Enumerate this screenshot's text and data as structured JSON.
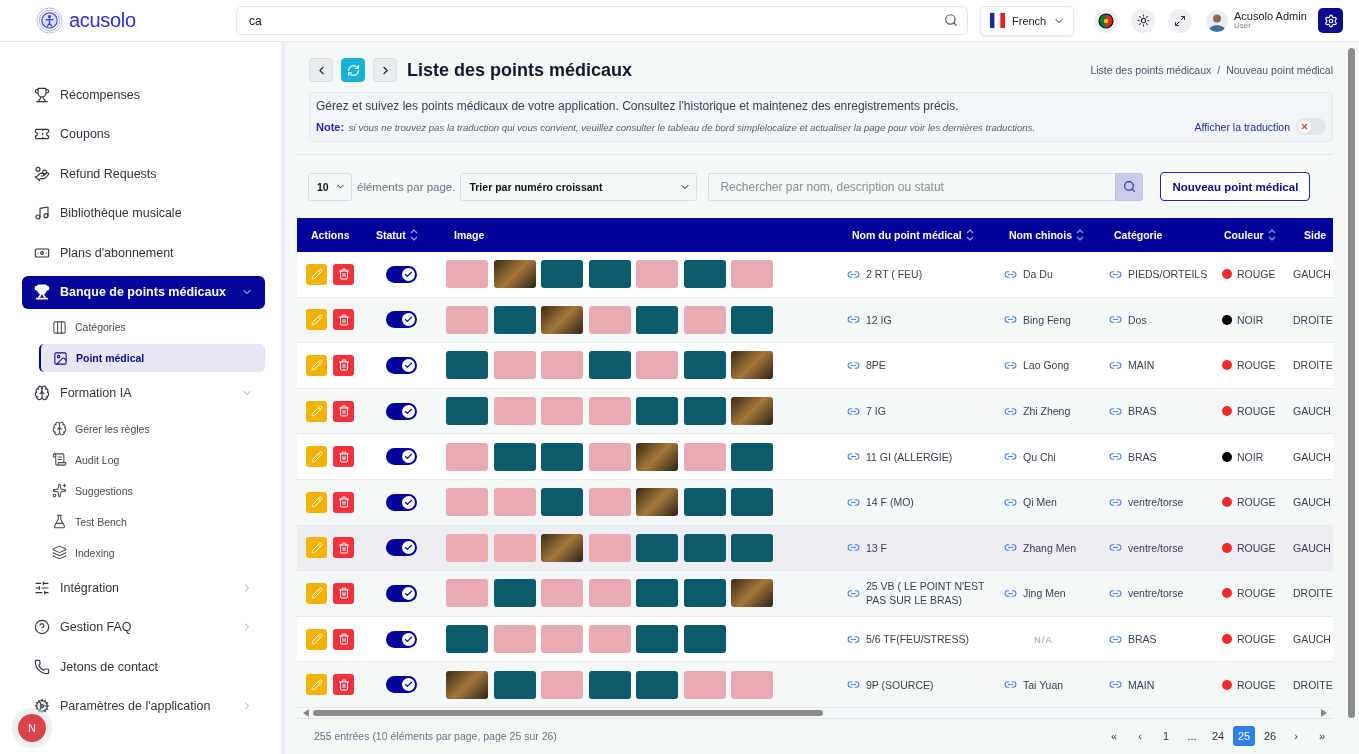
{
  "header": {
    "logo": "acusolo",
    "search": {
      "value": "ca"
    },
    "language": "French",
    "user": {
      "name": "Acusolo Admin",
      "role": "User"
    }
  },
  "sidebar": {
    "items": [
      {
        "label": "Récompenses"
      },
      {
        "label": "Coupons"
      },
      {
        "label": "Refund Requests"
      },
      {
        "label": "Bibliothèque musicale"
      },
      {
        "label": "Plans d'abonnement"
      },
      {
        "label": "Banque de points médicaux",
        "selected": true,
        "expanded": true,
        "children": [
          {
            "label": "Catégories",
            "selected": false
          },
          {
            "label": "Point médical",
            "selected": true
          }
        ]
      },
      {
        "label": "Formation IA",
        "selected": false,
        "expanded": true,
        "children": [
          {
            "label": "Gérer les règles",
            "selected": false
          },
          {
            "label": "Audit Log",
            "selected": false
          },
          {
            "label": "Suggestions",
            "selected": false
          },
          {
            "label": "Test Bench",
            "selected": false
          },
          {
            "label": "Indexing",
            "selected": false
          }
        ]
      },
      {
        "label": "Intégration",
        "selected": false,
        "expanded": false
      },
      {
        "label": "Gestion FAQ",
        "selected": false,
        "expanded": false
      },
      {
        "label": "Jetons de contact"
      },
      {
        "label": "Paramètres de l'application",
        "selected": false,
        "expanded": false
      }
    ],
    "avatar": "N"
  },
  "page": {
    "title": "Liste des points médicaux",
    "breadcrumb": [
      "Liste des points médicaux",
      "/",
      "Nouveau point médical"
    ],
    "description": "Gérez et suivez les points médicaux de votre application. Consultez l'historique et maintenez des enregistrements précis.",
    "note": "**Note:** *si vous ne trouvez pas la traduction qui vous convient, veuillez consulter le tableau de bord simplelocalize et actualiser la page pour voir les dernières traductions.*",
    "translation_toggle": {
      "label": "Afficher la traduction",
      "on": false
    }
  },
  "controls": {
    "per_page": "10",
    "per_page_label": "éléments par page.",
    "sort": "Trier par numéro croissant",
    "search": {
      "placeholder": "Rechercher par nom, description ou statut"
    },
    "new_button": "Nouveau point médical"
  },
  "table": {
    "columns": [
      {
        "label": "Actions",
        "sortable": false
      },
      {
        "label": "Statut",
        "sortable": true
      },
      {
        "label": "Image",
        "sortable": false
      },
      {
        "label": "Nom du point médical",
        "sortable": true
      },
      {
        "label": "Nom chinois",
        "sortable": true
      },
      {
        "label": "Catégorie",
        "sortable": false
      },
      {
        "label": "Couleur",
        "sortable": true
      },
      {
        "label": "Side",
        "sortable": false
      }
    ],
    "rows": [
      {
        "highlighted": false,
        "status": true,
        "images": [
          {
            "kind": "pink"
          },
          {
            "kind": "scene"
          },
          {
            "kind": "teal"
          },
          {
            "kind": "teal"
          },
          {
            "kind": "pink"
          },
          {
            "kind": "teal"
          },
          {
            "kind": "pink"
          }
        ],
        "name": "2 RT ( FEU)",
        "chinese": "Da Du",
        "category": "PIEDS/ORTEILS",
        "color": "#ef2b2b",
        "color_label": "ROUGE",
        "side": "GAUCH"
      },
      {
        "highlighted": false,
        "status": true,
        "images": [
          {
            "kind": "pink"
          },
          {
            "kind": "teal"
          },
          {
            "kind": "scene"
          },
          {
            "kind": "pink"
          },
          {
            "kind": "teal"
          },
          {
            "kind": "pink"
          },
          {
            "kind": "teal"
          }
        ],
        "name": "12 IG",
        "chinese": "Bing Feng",
        "category": "Dos",
        "color": "#000000",
        "color_label": "NOIR",
        "side": "DROITE"
      },
      {
        "highlighted": false,
        "status": true,
        "images": [
          {
            "kind": "teal"
          },
          {
            "kind": "pink"
          },
          {
            "kind": "pink"
          },
          {
            "kind": "teal"
          },
          {
            "kind": "pink"
          },
          {
            "kind": "teal"
          },
          {
            "kind": "scene"
          }
        ],
        "name": "8PE",
        "chinese": "Lao Gong",
        "category": "MAIN",
        "color": "#ef2b2b",
        "color_label": "ROUGE",
        "side": "DROITE"
      },
      {
        "highlighted": false,
        "status": true,
        "images": [
          {
            "kind": "teal"
          },
          {
            "kind": "pink"
          },
          {
            "kind": "pink"
          },
          {
            "kind": "pink"
          },
          {
            "kind": "teal"
          },
          {
            "kind": "teal"
          },
          {
            "kind": "scene"
          }
        ],
        "name": "7 IG",
        "chinese": "Zhi Zheng",
        "category": "BRAS",
        "color": "#ef2b2b",
        "color_label": "ROUGE",
        "side": "GAUCH"
      },
      {
        "highlighted": false,
        "status": true,
        "images": [
          {
            "kind": "pink"
          },
          {
            "kind": "teal"
          },
          {
            "kind": "teal"
          },
          {
            "kind": "pink"
          },
          {
            "kind": "scene"
          },
          {
            "kind": "pink"
          },
          {
            "kind": "teal"
          }
        ],
        "name": "11 GI (ALLERGIE)",
        "chinese": "Qu Chi",
        "category": "BRAS",
        "color": "#000000",
        "color_label": "NOIR",
        "side": "GAUCH"
      },
      {
        "highlighted": false,
        "status": true,
        "images": [
          {
            "kind": "pink"
          },
          {
            "kind": "pink"
          },
          {
            "kind": "teal"
          },
          {
            "kind": "pink"
          },
          {
            "kind": "scene"
          },
          {
            "kind": "teal"
          },
          {
            "kind": "teal"
          }
        ],
        "name": "14 F (MO)",
        "chinese": "Qi Men",
        "category": "ventre/torse",
        "color": "#ef2b2b",
        "color_label": "ROUGE",
        "side": "GAUCH"
      },
      {
        "highlighted": true,
        "status": true,
        "images": [
          {
            "kind": "pink"
          },
          {
            "kind": "pink"
          },
          {
            "kind": "scene"
          },
          {
            "kind": "pink"
          },
          {
            "kind": "teal"
          },
          {
            "kind": "teal"
          },
          {
            "kind": "teal"
          }
        ],
        "name": "13 F",
        "chinese": "Zhang Men",
        "category": "ventre/torse",
        "color": "#ef2b2b",
        "color_label": "ROUGE",
        "side": "GAUCH"
      },
      {
        "highlighted": false,
        "status": true,
        "images": [
          {
            "kind": "pink"
          },
          {
            "kind": "teal"
          },
          {
            "kind": "pink"
          },
          {
            "kind": "pink"
          },
          {
            "kind": "teal"
          },
          {
            "kind": "teal"
          },
          {
            "kind": "scene"
          }
        ],
        "name": "25 VB ( LE POINT N'EST PAS SUR LE BRAS)",
        "chinese": "Jing Men",
        "category": "ventre/torse",
        "color": "#ef2b2b",
        "color_label": "ROUGE",
        "side": "DROITE"
      },
      {
        "highlighted": false,
        "status": true,
        "images": [
          {
            "kind": "teal"
          },
          {
            "kind": "pink"
          },
          {
            "kind": "pink"
          },
          {
            "kind": "pink"
          },
          {
            "kind": "teal"
          },
          {
            "kind": "teal"
          }
        ],
        "name": "5/6 TF(FEU/STRESS)",
        "chinese": "N/A",
        "chinese_missing": true,
        "category": "BRAS",
        "color": "#ef2b2b",
        "color_label": "ROUGE",
        "side": "GAUCH"
      },
      {
        "highlighted": false,
        "status": true,
        "images": [
          {
            "kind": "scene"
          },
          {
            "kind": "teal"
          },
          {
            "kind": "pink"
          },
          {
            "kind": "teal"
          },
          {
            "kind": "teal"
          },
          {
            "kind": "pink"
          },
          {
            "kind": "pink"
          }
        ],
        "name": "9P (SOURCE)",
        "chinese": "Tai Yuan",
        "category": "MAIN",
        "color": "#ef2b2b",
        "color_label": "ROUGE",
        "side": "DROITE"
      }
    ]
  },
  "footer": {
    "summary": "255 entrées (10 éléments par page, page 25 sur 26)",
    "pages": [
      {
        "label": "«",
        "selected": false
      },
      {
        "label": "‹",
        "selected": false
      },
      {
        "label": "1",
        "selected": false
      },
      {
        "label": "...",
        "selected": false
      },
      {
        "label": "24",
        "selected": false
      },
      {
        "label": "25",
        "selected": true
      },
      {
        "label": "26",
        "selected": false
      },
      {
        "label": "›",
        "selected": false
      },
      {
        "label": "»",
        "selected": false
      }
    ]
  }
}
